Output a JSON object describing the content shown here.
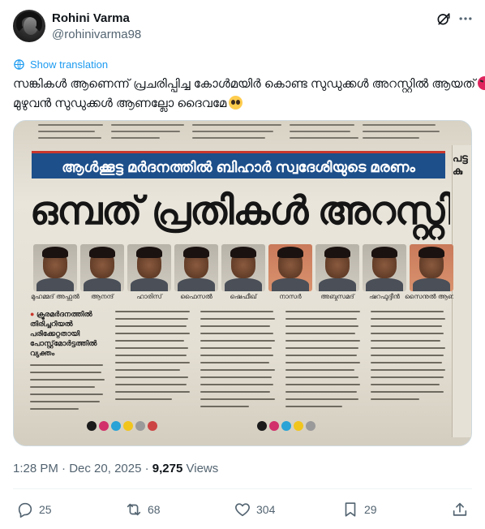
{
  "post": {
    "author_name": "Rohini Varma",
    "author_handle": "@rohinivarma98",
    "show_translation": "Show translation",
    "text_line_1": "സങ്കികൾ ആണെന്ന് പ്രചരിപ്പിച്ച കോൾമയിർ കൊണ്ട സുഡുക്കൾ അറസ്റ്റിൽ ആയത്",
    "text_line_2": "മുഴുവൻ സുഡുക്കൾ ആണല്ലോ ദൈവമേ",
    "time": "1:28 PM",
    "date": "Dec 20, 2025",
    "views_count": "9,275",
    "views_label": "Views"
  },
  "newspaper": {
    "subhead": "ആൾക്കൂട്ട മർദനത്തിൽ ബിഹാർ സ്വദേശിയുടെ മരണം",
    "headline": "ഒമ്പത് പ്രതികൾ അറസ്റ്റിൽ",
    "side_heading": "പട്ട കു",
    "captions": [
      "മുഹമ്മദ് അഫ്സൽ",
      "ആനന്ദ്",
      "ഹാരിസ്",
      "ഫൈസൽ",
      "ഷെഫീഖ്",
      "നാസർ",
      "അബ്ദുസമദ്",
      "ഷറഫുദ്ദീൻ",
      "സൈനുൽ ആബിദ്"
    ],
    "bullet_lines": [
      "ക്രൂരമർദനത്തിൽ",
      "തിരിച്ചറിയൽ",
      "പരിക്കേറ്റതായി",
      "പോസ്റ്റ്‌മോർട്ടത്തിൽ",
      "വ്യക്തം"
    ]
  },
  "actions": {
    "replies": "25",
    "reposts": "68",
    "likes": "304",
    "bookmarks": "29"
  },
  "icons": {
    "grok": "grok-icon",
    "more": "more-icon",
    "translate": "globe-icon",
    "reply": "reply-icon",
    "repost": "repost-icon",
    "like": "heart-icon",
    "bookmark": "bookmark-icon",
    "share": "share-icon"
  },
  "colors": {
    "link": "#1d9bf0",
    "secondary_text": "#536471",
    "primary_text": "#0f1419",
    "newspaper_banner": "#1d4f8a"
  }
}
